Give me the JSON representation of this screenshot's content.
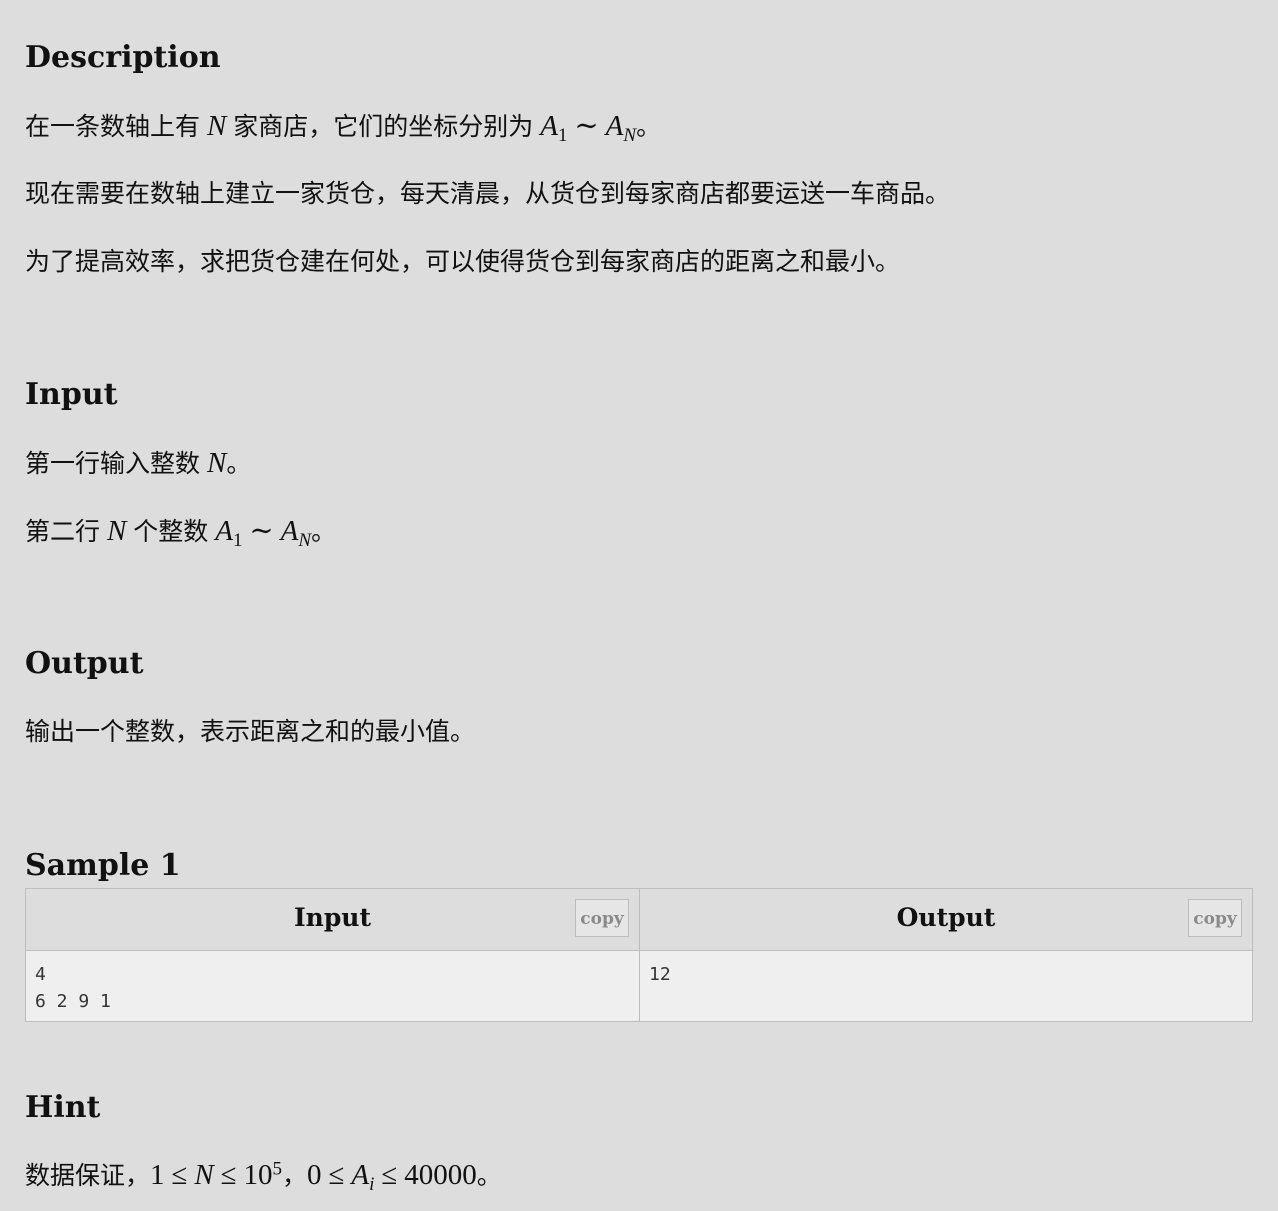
{
  "description": {
    "heading": "Description",
    "p1": {
      "a": "在一条数轴上有",
      "n": "N",
      "b": "家商店，它们的坐标分别为",
      "a_var": "A",
      "sub1": "1",
      "tilde": "∼",
      "sub_n": "N",
      "end": "。"
    },
    "p2": "现在需要在数轴上建立一家货仓，每天清晨，从货仓到每家商店都要运送一车商品。",
    "p3": "为了提高效率，求把货仓建在何处，可以使得货仓到每家商店的距离之和最小。"
  },
  "input": {
    "heading": "Input",
    "p1": {
      "a": "第一行输入整数",
      "n": "N",
      "end": "。"
    },
    "p2": {
      "a": "第二行",
      "n": "N",
      "b": "个整数",
      "a_var": "A",
      "sub1": "1",
      "tilde": "∼",
      "sub_n": "N",
      "end": "。"
    }
  },
  "output": {
    "heading": "Output",
    "p1": "输出一个整数，表示距离之和的最小值。"
  },
  "sample": {
    "heading": "Sample 1",
    "input_title": "Input",
    "output_title": "Output",
    "copy_label": "copy",
    "input_text": "4\n6 2 9 1",
    "output_text": "12"
  },
  "hint": {
    "heading": "Hint",
    "a": "数据保证，",
    "one": "1",
    "le": "≤",
    "n": "N",
    "ten": "10",
    "exp": "5",
    "comma": "，",
    "zero": "0",
    "a_var": "A",
    "sub_i": "i",
    "max": "40000",
    "end": "。"
  }
}
